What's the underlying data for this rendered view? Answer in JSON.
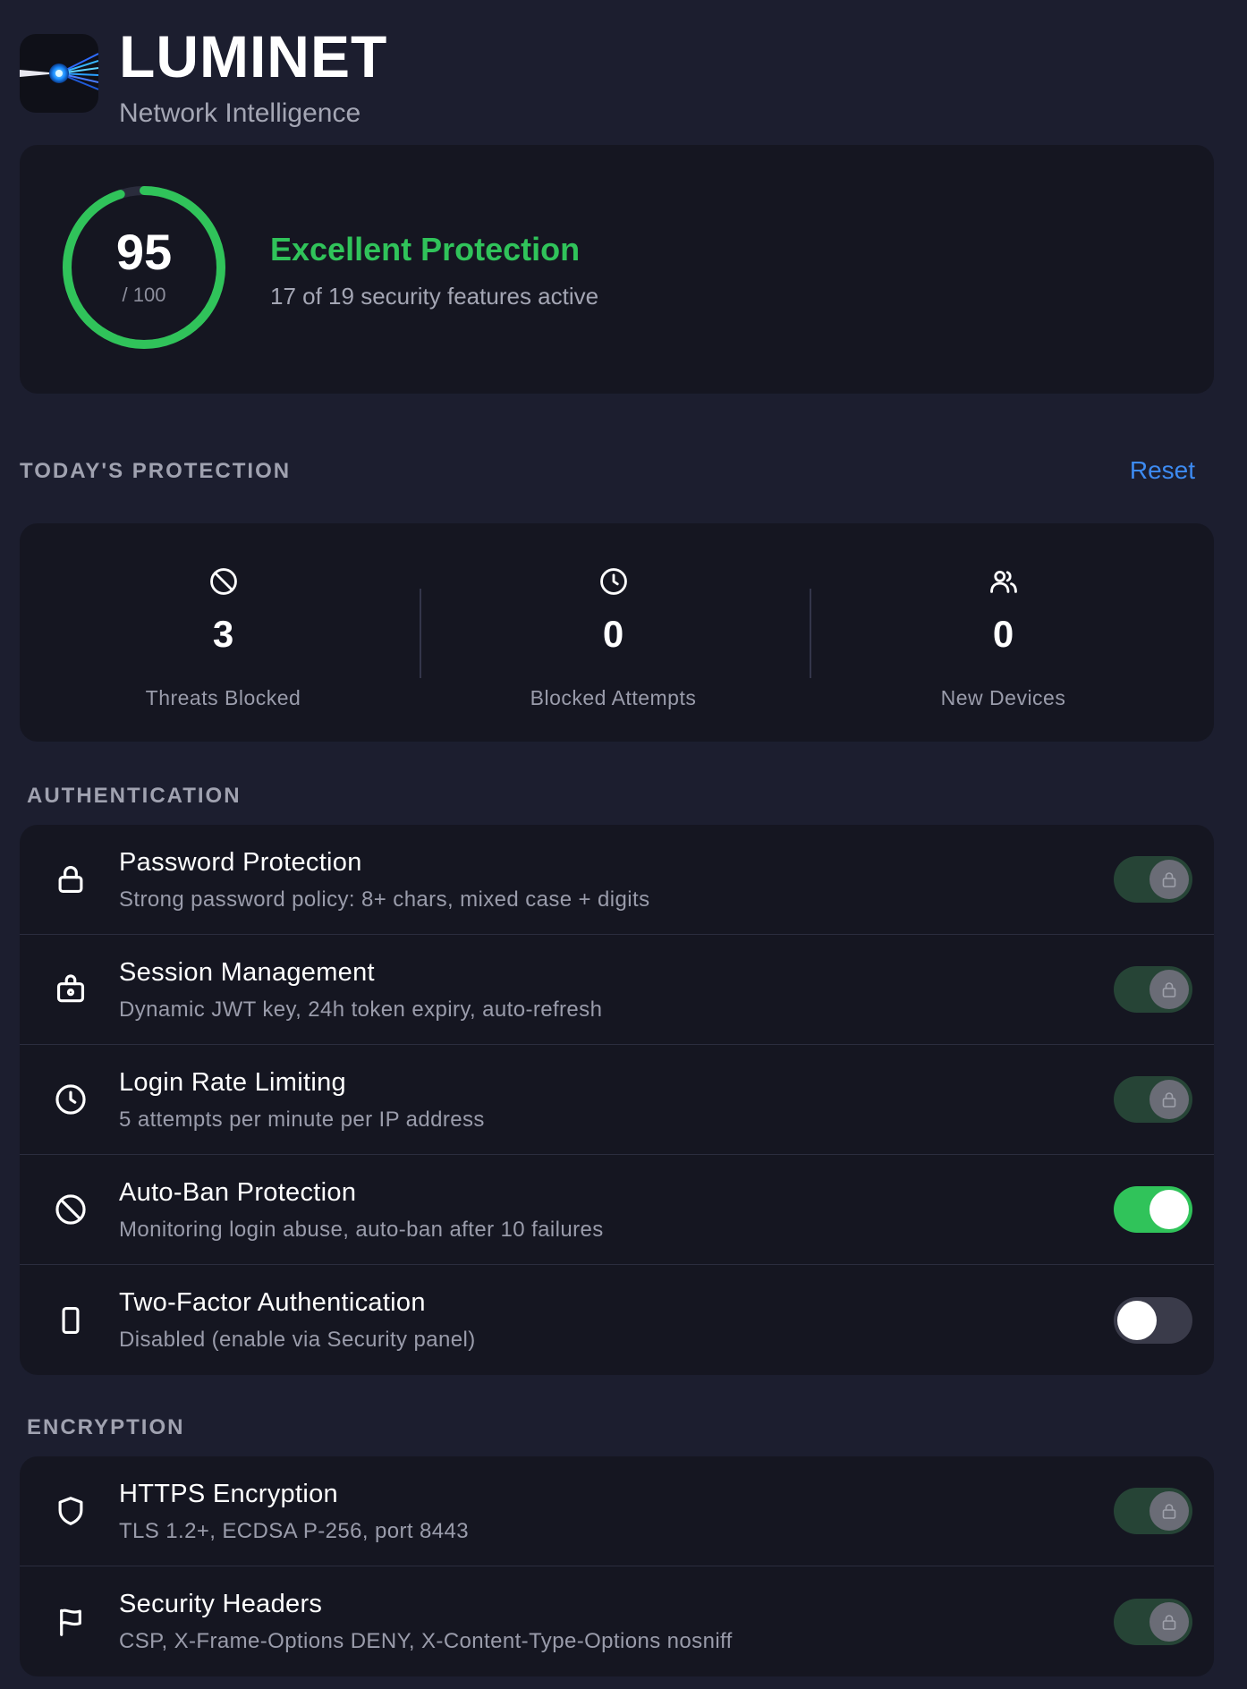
{
  "app": {
    "title": "LUMINET",
    "subtitle": "Network Intelligence"
  },
  "score": {
    "value": "95",
    "max_label": "/ 100",
    "fraction": 0.95,
    "status": "Excellent Protection",
    "detail": "17 of 19 security features active",
    "color": "#30c35a"
  },
  "today": {
    "section_title": "TODAY'S PROTECTION",
    "reset_label": "Reset",
    "stats": [
      {
        "icon": "ban-icon",
        "value": "3",
        "label": "Threats Blocked"
      },
      {
        "icon": "clock-icon",
        "value": "0",
        "label": "Blocked Attempts"
      },
      {
        "icon": "users-icon",
        "value": "0",
        "label": "New Devices"
      }
    ]
  },
  "authentication": {
    "section_title": "AUTHENTICATION",
    "items": [
      {
        "icon": "lock-icon",
        "title": "Password Protection",
        "description": "Strong password policy: 8+ chars, mixed case + digits",
        "state": "locked"
      },
      {
        "icon": "briefcase-lock-icon",
        "title": "Session Management",
        "description": "Dynamic JWT key, 24h token expiry, auto-refresh",
        "state": "locked"
      },
      {
        "icon": "clock-icon",
        "title": "Login Rate Limiting",
        "description": "5 attempts per minute per IP address",
        "state": "locked"
      },
      {
        "icon": "ban-icon",
        "title": "Auto-Ban Protection",
        "description": "Monitoring login abuse, auto-ban after 10 failures",
        "state": "on"
      },
      {
        "icon": "phone-icon",
        "title": "Two-Factor Authentication",
        "description": "Disabled (enable via Security panel)",
        "state": "off"
      }
    ]
  },
  "encryption": {
    "section_title": "ENCRYPTION",
    "items": [
      {
        "icon": "shield-icon",
        "title": "HTTPS Encryption",
        "description": "TLS 1.2+, ECDSA P-256, port 8443",
        "state": "locked"
      },
      {
        "icon": "flag-icon",
        "title": "Security Headers",
        "description": "CSP, X-Frame-Options DENY, X-Content-Type-Options nosniff",
        "state": "locked"
      }
    ]
  }
}
